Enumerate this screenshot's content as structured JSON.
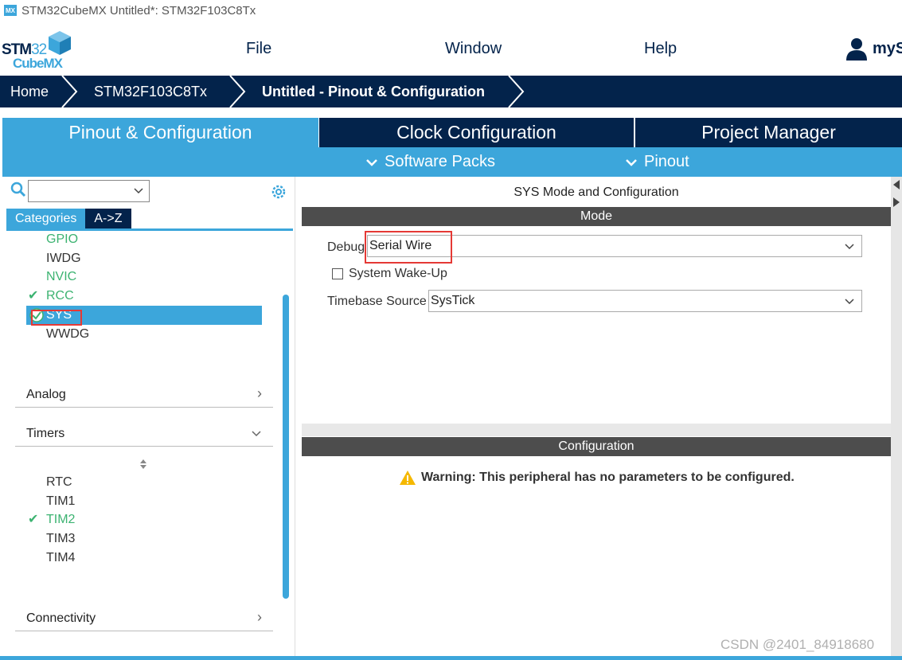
{
  "window": {
    "app_icon": "MX",
    "title": "STM32CubeMX Untitled*: STM32F103C8Tx"
  },
  "logo": {
    "line1a": "STM",
    "line1b": "32",
    "line2": "CubeMX"
  },
  "menu": {
    "file": "File",
    "window": "Window",
    "help": "Help",
    "user": "myS"
  },
  "breadcrumb": [
    "Home",
    "STM32F103C8Tx",
    "Untitled - Pinout & Configuration"
  ],
  "tabs": {
    "pinout": "Pinout & Configuration",
    "clock": "Clock Configuration",
    "project": "Project Manager"
  },
  "subbar": {
    "software_packs": "Software Packs",
    "pinout": "Pinout"
  },
  "left": {
    "search_value": "",
    "tab_categories": "Categories",
    "tab_az": "A->Z",
    "system_core": [
      {
        "label": "GPIO",
        "state": "green",
        "checked": false
      },
      {
        "label": "IWDG",
        "state": "plain",
        "checked": false
      },
      {
        "label": "NVIC",
        "state": "green",
        "checked": false
      },
      {
        "label": "RCC",
        "state": "green",
        "checked": true
      },
      {
        "label": "SYS",
        "state": "selected",
        "checked": true
      },
      {
        "label": "WWDG",
        "state": "plain",
        "checked": false
      }
    ],
    "sections": {
      "analog": "Analog",
      "timers": "Timers",
      "connectivity": "Connectivity"
    },
    "timers": [
      {
        "label": "RTC",
        "state": "plain",
        "checked": false
      },
      {
        "label": "TIM1",
        "state": "plain",
        "checked": false
      },
      {
        "label": "TIM2",
        "state": "green",
        "checked": true
      },
      {
        "label": "TIM3",
        "state": "plain",
        "checked": false
      },
      {
        "label": "TIM4",
        "state": "plain",
        "checked": false
      }
    ]
  },
  "right": {
    "title": "SYS Mode and Configuration",
    "mode_header": "Mode",
    "debug_label": "Debug",
    "debug_value": "Serial Wire",
    "wakeup_label": "System Wake-Up",
    "wakeup_checked": false,
    "timebase_label": "Timebase Source",
    "timebase_value": "SysTick",
    "config_header": "Configuration",
    "warning": "Warning: This peripheral has no parameters to be configured."
  },
  "watermark": "CSDN @2401_84918680",
  "colors": {
    "navy": "#03234b",
    "blue": "#3ca6db",
    "green": "#3cb371",
    "highlight": "#e53935"
  }
}
